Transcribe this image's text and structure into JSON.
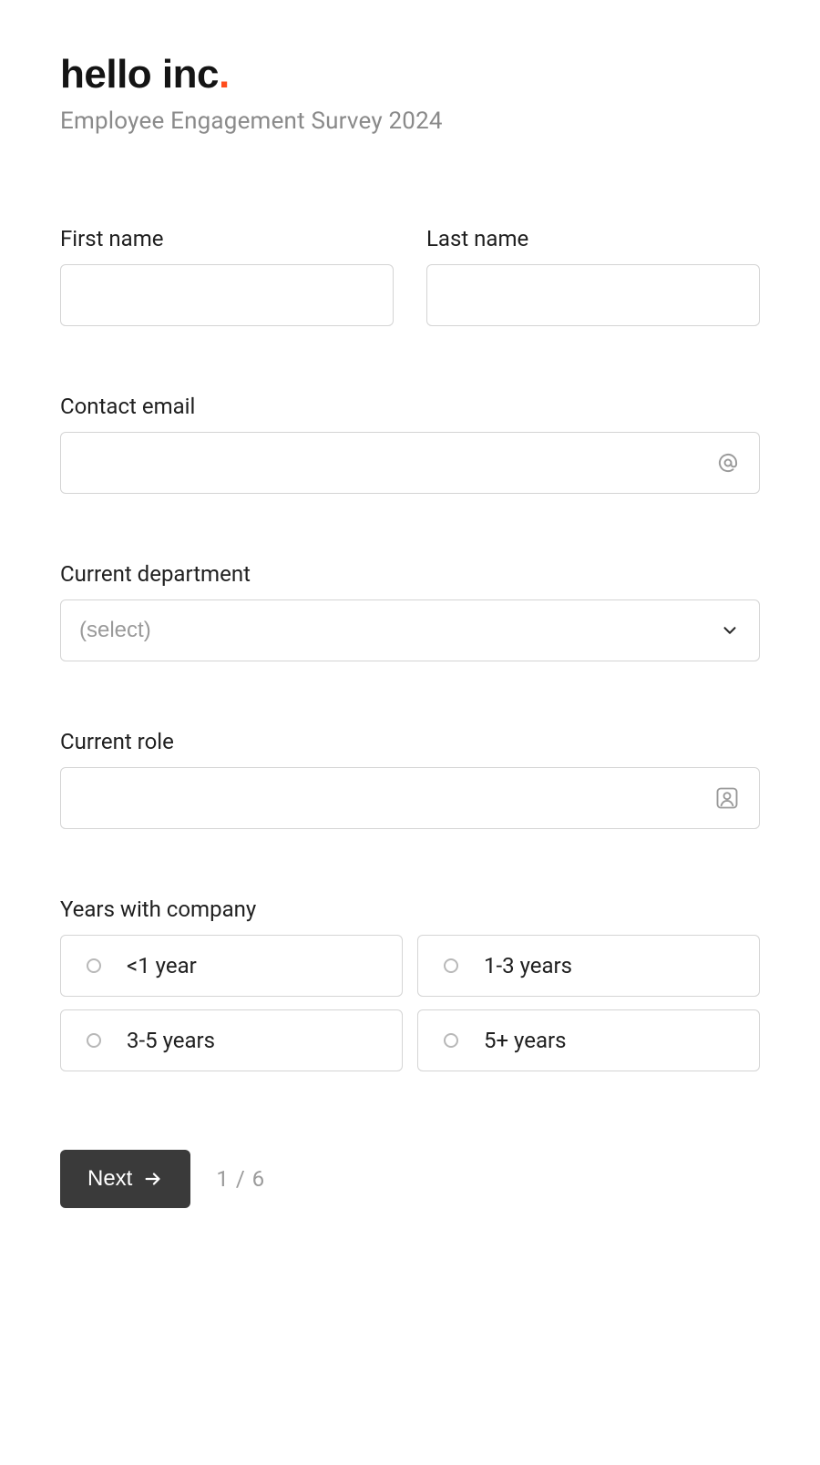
{
  "brand": {
    "name": "hello inc",
    "dot": "."
  },
  "subtitle": "Employee Engagement Survey 2024",
  "fields": {
    "first_name": {
      "label": "First name",
      "value": ""
    },
    "last_name": {
      "label": "Last name",
      "value": ""
    },
    "email": {
      "label": "Contact email",
      "value": ""
    },
    "department": {
      "label": "Current department",
      "placeholder": "(select)"
    },
    "role": {
      "label": "Current role",
      "value": ""
    },
    "tenure": {
      "label": "Years with company",
      "options": [
        "<1 year",
        "1-3 years",
        "3-5 years",
        "5+ years"
      ]
    }
  },
  "footer": {
    "next_label": "Next",
    "page_current": "1",
    "page_sep": " / ",
    "page_total": "6"
  }
}
